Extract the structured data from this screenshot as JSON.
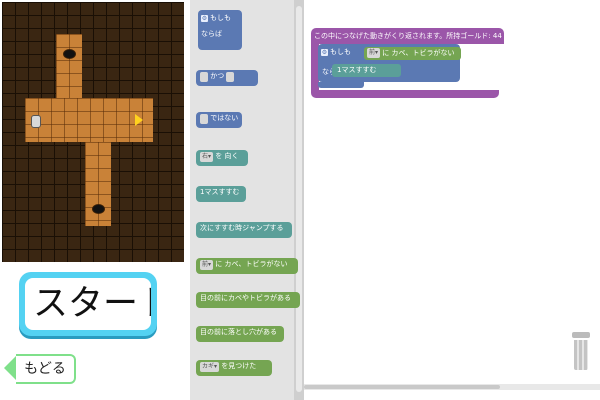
{
  "game": {
    "start_button_label": "スタート`",
    "back_button_label": "もどる"
  },
  "palette": {
    "if_label": "もしも",
    "then_label": "ならば",
    "and_label": "かつ",
    "not_label": "ではない",
    "turn_slot": "右▾",
    "turn_label": "を 向く",
    "move_label": "1マスすすむ",
    "jump_label": "次にすすむ時ジャンプする",
    "wall_slot": "前▾",
    "wall_label": "に カベ、トビラがない",
    "front_wall_label": "目の前にカベやトビラがある",
    "front_hole_label": "目の前に落とし穴がある",
    "found_slot": "カギ▾",
    "found_label": "を見つけた"
  },
  "workspace": {
    "loop_label": "この中につなげた動きがくり返されます。所持ゴールド: 44",
    "if_label": "もしも",
    "cond_slot": "前▾",
    "cond_label": "に カベ、トビラがない",
    "then_label": "ならば",
    "move_label": "1マスすすむ"
  },
  "colors": {
    "logic": "#5b79b3",
    "action": "#5b9f99",
    "sensor": "#75a552",
    "loop": "#9b56a9",
    "start_button": "#54d2f2",
    "back_button": "#7fe08a",
    "path": "#c98238",
    "goal": "#ffd21e"
  },
  "icons": [
    "gear-icon",
    "trash-icon",
    "back-arrow-icon",
    "goal-arrow-icon",
    "robot-icon",
    "hole-icon"
  ]
}
